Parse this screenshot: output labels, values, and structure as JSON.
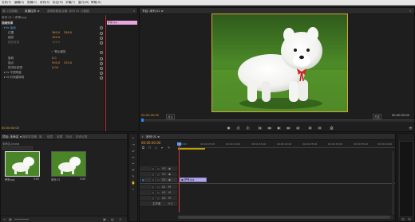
{
  "menu": [
    "文件(F)",
    "编辑(E)",
    "剪辑(C)",
    "序列(S)",
    "标记(M)",
    "字幕(T)",
    "窗口(W)",
    "帮助(H)"
  ],
  "effect_controls": {
    "tabs": [
      "源: (无剪辑)",
      "效果控件 ≡",
      "音频剪辑混合器: 序列 01",
      "元数据"
    ],
    "clip_label": "序列 01 * 萨摩.jpg",
    "mini_clip_label": "萨摩.jpg",
    "section_title": "视频效果",
    "rows": [
      {
        "name": "▾ fx 运动",
        "v1": "",
        "v2": "",
        "style": "blue"
      },
      {
        "name": "位置",
        "v1": "360.0",
        "v2": "288.0",
        "style": "plain"
      },
      {
        "name": "缩放",
        "v1": "100.0",
        "v2": "",
        "style": "plain"
      },
      {
        "name": "缩放宽度",
        "v1": "100.0",
        "v2": "",
        "style": "plain"
      },
      {
        "name": "",
        "v1": "✓ 等比缩放",
        "v2": "",
        "style": "plain"
      },
      {
        "name": "旋转",
        "v1": "0.0",
        "v2": "",
        "style": "plain"
      },
      {
        "name": "锚点",
        "v1": "500.0",
        "v2": "333.0",
        "style": "plain"
      },
      {
        "name": "防闪烁滤镜",
        "v1": "0.00",
        "v2": "",
        "style": "plain"
      },
      {
        "name": "▸ fx 不透明度",
        "v1": "",
        "v2": "",
        "style": "plain"
      },
      {
        "name": "▸ fx 时间重映射",
        "v1": "",
        "v2": "",
        "style": "plain"
      }
    ],
    "timecode": "00:00:00:00"
  },
  "program": {
    "tab": "节目: 序列 01 ≡",
    "timecode_left": "00:00:00:00",
    "fit": "适合",
    "quality": "完整",
    "timecode_right": "00:00:05:00",
    "transport_icons": [
      "◆",
      "{",
      "}",
      "|◂",
      "◂◂",
      "▶",
      "▸▸",
      "▸|",
      "⊞",
      "⊟",
      "⎙",
      "+"
    ]
  },
  "project": {
    "tabs": [
      "项目: 未命名 ≡",
      "媒体浏览器",
      "库",
      "信息",
      "效果",
      "标记",
      "历史记录"
    ],
    "path": "未命名.prproj",
    "items": [
      {
        "name": "萨摩.jpg",
        "duration": "5:00"
      },
      {
        "name": "序列 01",
        "duration": "5:00"
      }
    ]
  },
  "timeline": {
    "tab": "序列 01 ≡",
    "timecode": "00:00:00:00",
    "ruler": [
      "00:00",
      "00:00:05:00",
      "00:00:10:00",
      "00:00:15:00",
      "00:00:20:00",
      "00:00:25:00",
      "00:00:30:00",
      "00:00:35:00",
      "00:00:40:00"
    ],
    "video_tracks": [
      "V3",
      "V2",
      "V1"
    ],
    "audio_tracks": [
      "A1",
      "A2",
      "A3"
    ],
    "master_label": "主声道",
    "master_value": "0.0",
    "clip_label": "萨摩.jpg"
  },
  "colors": {
    "accent_blue": "#2d8cf0",
    "playhead": "#d03a3a",
    "timecode": "#e89a3c",
    "clip": "#b4a7e6"
  }
}
